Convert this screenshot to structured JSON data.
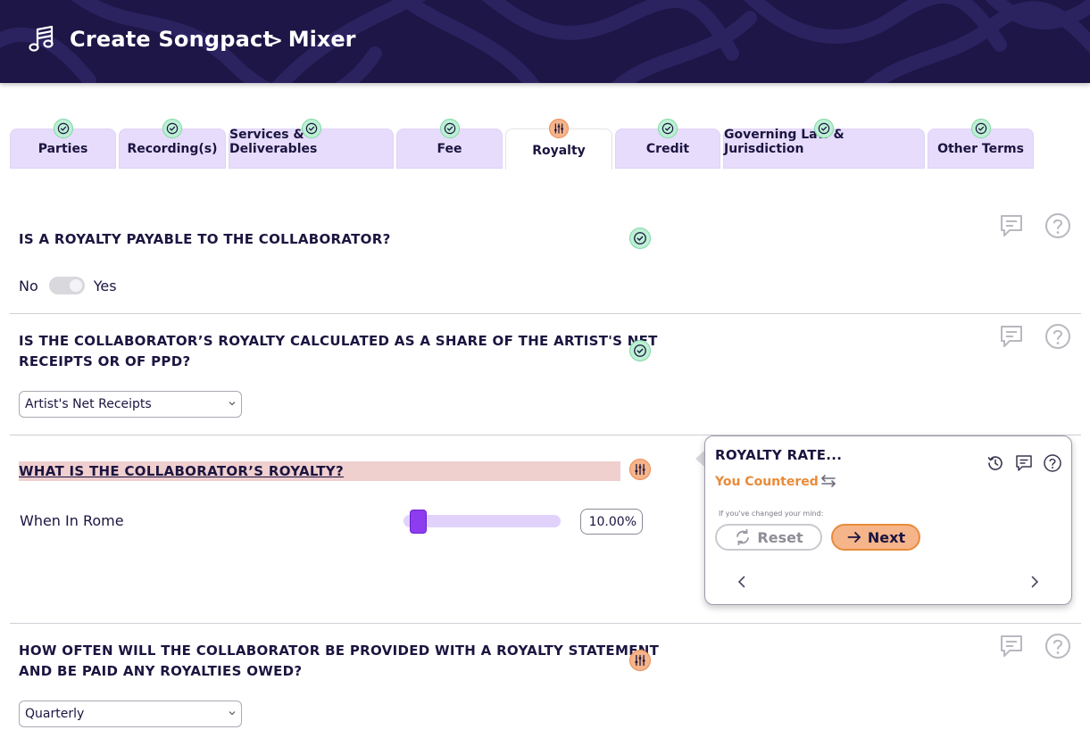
{
  "header": {
    "title": "Create Songpact",
    "breadcrumb_sep": ">",
    "breadcrumb": "Mixer",
    "bg_color": "#1d1646"
  },
  "tabs": [
    {
      "label": "Parties",
      "status": "complete"
    },
    {
      "label": "Recording(s)",
      "status": "complete"
    },
    {
      "label": "Services & Deliverables",
      "status": "complete"
    },
    {
      "label": "Fee",
      "status": "complete"
    },
    {
      "label": "Royalty",
      "status": "negotiating",
      "active": true
    },
    {
      "label": "Credit",
      "status": "complete"
    },
    {
      "label": "Governing Law & Jurisdiction",
      "status": "complete"
    },
    {
      "label": "Other Terms",
      "status": "complete"
    }
  ],
  "questions": {
    "q1": {
      "title": "IS A ROYALTY PAYABLE TO THE COLLABORATOR?",
      "toggle_off_label": "No",
      "toggle_on_label": "Yes"
    },
    "q2": {
      "title_line1": "IS THE COLLABORATOR’S ROYALTY CALCULATED AS A SHARE OF THE ARTIST'S NET",
      "title_line2": "RECEIPTS OR OF PPD?",
      "selected": "Artist's Net Receipts"
    },
    "q3": {
      "title": "WHAT IS THE COLLABORATOR’S ROYALTY?",
      "slider_label": "When In Rome",
      "slider_value": "10.00%",
      "slider_fraction": 0.06
    },
    "q4": {
      "title_line1": "HOW OFTEN WILL THE COLLABORATOR BE PROVIDED WITH A ROYALTY STATEMENT",
      "title_line2": "AND BE PAID ANY ROYALTIES OWED?",
      "selected": "Quarterly"
    }
  },
  "popover": {
    "title": "ROYALTY RATE...",
    "status": "You Countered",
    "hint": "If you've changed your mind:",
    "reset_label": "Reset",
    "next_label": "Next"
  },
  "colors": {
    "accent": "#8d3cf0",
    "complete": "#bdf0d4",
    "negotiating": "#f6b48a",
    "countered_text": "#e98b3a"
  }
}
